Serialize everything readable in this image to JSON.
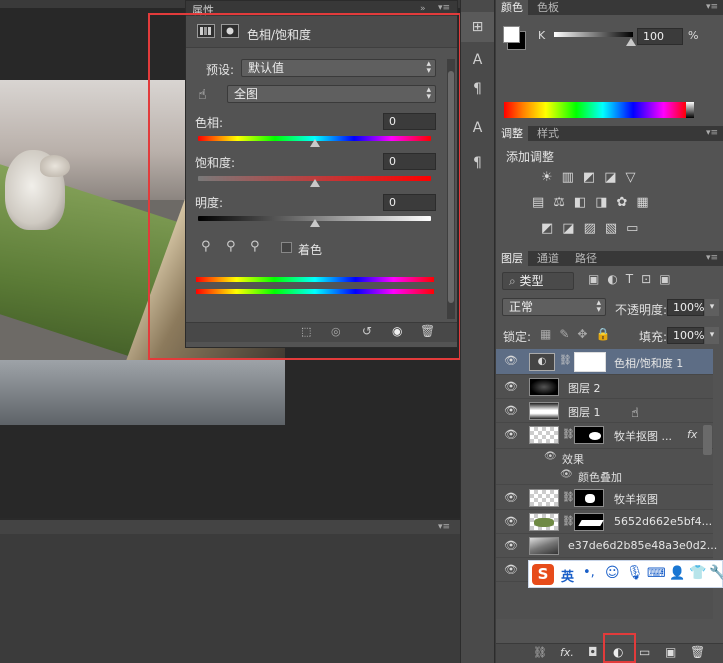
{
  "properties_panel": {
    "tab_label": "属性",
    "title": "色相/饱和度",
    "preset_label": "预设:",
    "preset_value": "默认值",
    "channel_value": "全图",
    "hue_label": "色相:",
    "hue_value": "0",
    "saturation_label": "饱和度:",
    "saturation_value": "0",
    "lightness_label": "明度:",
    "lightness_value": "0",
    "colorize_label": "着色"
  },
  "color_panel": {
    "tabs": [
      "颜色",
      "色板"
    ],
    "channel_label": "K",
    "value": "100",
    "unit": "%"
  },
  "adjustments_panel": {
    "tabs": [
      "调整",
      "样式"
    ],
    "heading": "添加调整"
  },
  "layers_panel": {
    "tabs": [
      "图层",
      "通道",
      "路径"
    ],
    "filter_label": "类型",
    "blend_mode": "正常",
    "opacity_label": "不透明度:",
    "opacity_value": "100%",
    "lock_label": "锁定:",
    "fill_label": "填充:",
    "fill_value": "100%",
    "fx_label": "fx",
    "effects_label": "效果",
    "color_overlay_label": "颜色叠加",
    "layers": [
      {
        "name": "色相/饱和度 1"
      },
      {
        "name": "图层 2"
      },
      {
        "name": "图层 1"
      },
      {
        "name": "牧羊抠图 ..."
      },
      {
        "name": "牧羊抠图"
      },
      {
        "name": "5652d662e5bf4..."
      },
      {
        "name": "e37de6d2b85e48a3e0d2..."
      }
    ]
  },
  "ime_bar": {
    "lang": "英",
    "punct": "•,"
  },
  "colors": {
    "annotation_red": "#e23b3b",
    "panel_bg": "#535353",
    "selected_layer": "#5d6d85"
  }
}
